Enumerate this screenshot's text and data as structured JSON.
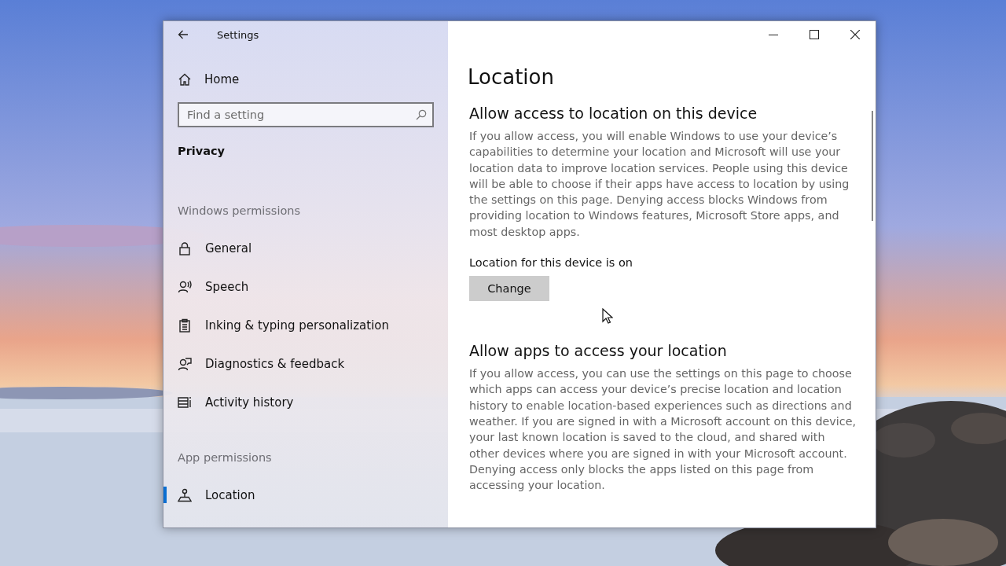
{
  "window": {
    "title": "Settings"
  },
  "sidebar": {
    "home": "Home",
    "search": {
      "placeholder": "Find a setting"
    },
    "section": "Privacy",
    "groups": [
      {
        "heading": "Windows permissions",
        "items": [
          {
            "label": "General",
            "selected": false
          },
          {
            "label": "Speech",
            "selected": false
          },
          {
            "label": "Inking & typing personalization",
            "selected": false
          },
          {
            "label": "Diagnostics & feedback",
            "selected": false
          },
          {
            "label": "Activity history",
            "selected": false
          }
        ]
      },
      {
        "heading": "App permissions",
        "items": [
          {
            "label": "Location",
            "selected": true
          }
        ]
      }
    ]
  },
  "content": {
    "title": "Location",
    "sections": [
      {
        "heading": "Allow access to location on this device",
        "body": "If you allow access, you will enable Windows to use your device’s capabilities to determine your location and Microsoft will use your location data to improve location services. People using this device will be able to choose if their apps have access to location by using the settings on this page. Denying access blocks Windows from providing location to Windows features, Microsoft Store apps, and most desktop apps.",
        "status": "Location for this device is on",
        "button": "Change"
      },
      {
        "heading": "Allow apps to access your location",
        "body": "If you allow access, you can use the settings on this page to choose which apps can access your device’s precise location and location history to enable location-based experiences such as directions and weather. If you are signed in with a Microsoft account on this device, your last known location is saved to the cloud, and shared with other devices where you are signed in with your Microsoft account. Denying access only blocks the apps listed on this page from accessing your location."
      }
    ]
  }
}
